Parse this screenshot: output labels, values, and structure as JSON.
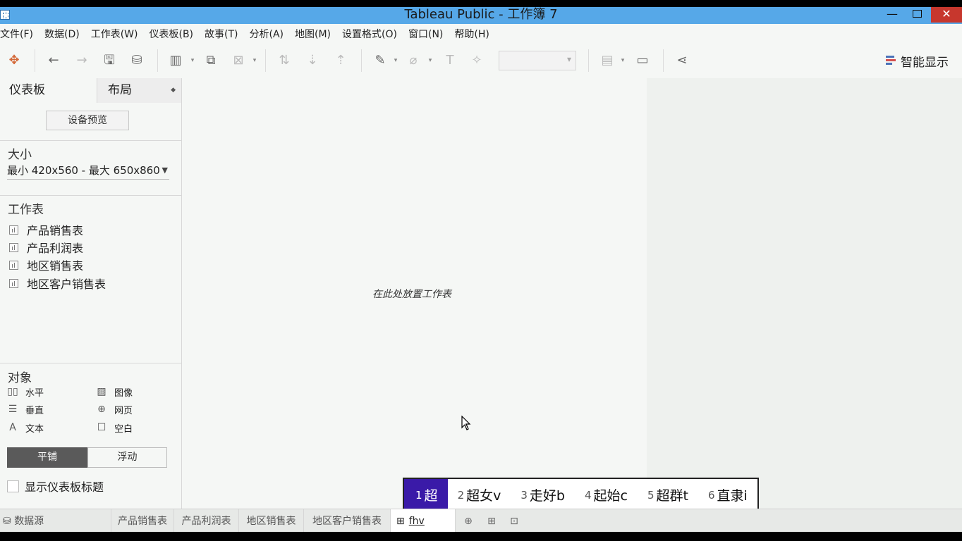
{
  "window": {
    "title": "Tableau Public - 工作簿 7",
    "min_glyph": "—",
    "close_glyph": "✕"
  },
  "menu": [
    "文件(F)",
    "数据(D)",
    "工作表(W)",
    "仪表板(B)",
    "故事(T)",
    "分析(A)",
    "地图(M)",
    "设置格式(O)",
    "窗口(N)",
    "帮助(H)"
  ],
  "toolbar": {
    "smart_show": "智能显示",
    "glyphs": {
      "tableau": "✥",
      "back": "←",
      "forward": "→",
      "save": "🖫",
      "new_datasource": "⛁",
      "new_sheet": "▥",
      "duplicate": "⧉",
      "clear": "⊠",
      "swap": "⇅",
      "sort_asc": "⇣",
      "sort_desc": "⇡",
      "highlight": "✎",
      "group": "⌀",
      "label": "T",
      "pin": "✧",
      "show_me": "▤",
      "presentation": "▭",
      "share": "⋖"
    }
  },
  "panel": {
    "tab_dashboard": "仪表板",
    "tab_layout": "布局",
    "tab_layout_arrow": "◆",
    "device_preview": "设备预览",
    "size_title": "大小",
    "size_value": "最小 420x560 - 最大 650x860",
    "size_caret": "▼",
    "sheets_title": "工作表",
    "sheets": [
      "产品销售表",
      "产品利润表",
      "地区销售表",
      "地区客户销售表"
    ],
    "objects_title": "对象",
    "objects": [
      {
        "label": "水平",
        "icon": "▯▯"
      },
      {
        "label": "图像",
        "icon": "▨"
      },
      {
        "label": "垂直",
        "icon": "☰"
      },
      {
        "label": "网页",
        "icon": "⊕"
      },
      {
        "label": "文本",
        "icon": "A"
      },
      {
        "label": "空白",
        "icon": "☐"
      }
    ],
    "tile": "平铺",
    "float": "浮动",
    "show_title": "显示仪表板标题"
  },
  "canvas": {
    "drop_hint": "在此处放置工作表"
  },
  "ime": {
    "candidates": [
      {
        "n": "1",
        "text": "超"
      },
      {
        "n": "2",
        "text": "超女v"
      },
      {
        "n": "3",
        "text": "走好b"
      },
      {
        "n": "4",
        "text": "起始c"
      },
      {
        "n": "5",
        "text": "超群t"
      },
      {
        "n": "6",
        "text": "直隶i"
      }
    ]
  },
  "bottom": {
    "datasource": "数据源",
    "datasource_icon": "⛁",
    "tabs": [
      "产品销售表",
      "产品利润表",
      "地区销售表",
      "地区客户销售表"
    ],
    "active_tab": "fhv",
    "active_icon": "⊞",
    "icons": [
      "⊕",
      "⊞",
      "⊡"
    ]
  }
}
